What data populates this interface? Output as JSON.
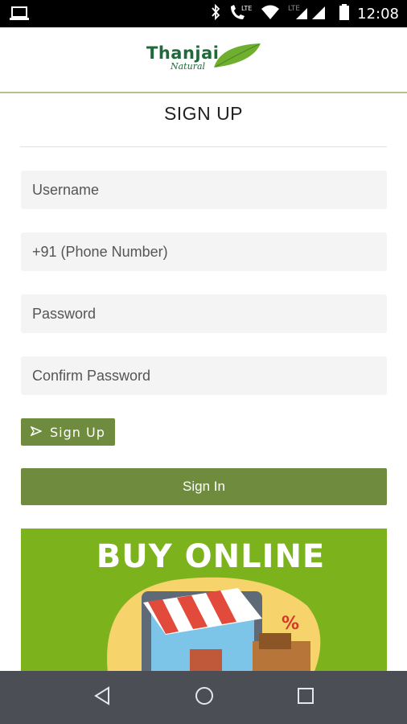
{
  "status_bar": {
    "time": "12:08",
    "network_label": "LTE",
    "roaming_label": "R"
  },
  "header": {
    "logo_text": "Thanjai",
    "logo_subtext": "Natural"
  },
  "page": {
    "title": "SIGN UP"
  },
  "form": {
    "username_placeholder": "Username",
    "phone_placeholder": "+91 (Phone Number)",
    "password_placeholder": "Password",
    "confirm_password_placeholder": "Confirm Password",
    "signup_label": "Sign Up",
    "signin_label": "Sign In"
  },
  "banner": {
    "title": "BUY ONLINE",
    "badge": "%"
  },
  "colors": {
    "accent_green": "#6f8c3e",
    "banner_green": "#7cb21c",
    "logo_green": "#1f6a3a",
    "nav_bar": "#4b4f55"
  },
  "icons": {
    "status": [
      "laptop-icon",
      "bluetooth-icon",
      "call-icon",
      "wifi-icon",
      "signal-icon",
      "battery-icon"
    ],
    "nav": [
      "back-icon",
      "home-icon",
      "recents-icon"
    ],
    "signup": "send-icon"
  }
}
